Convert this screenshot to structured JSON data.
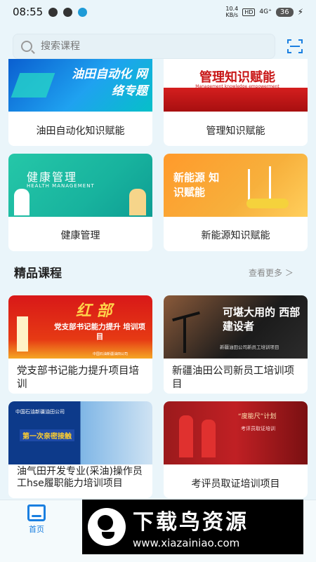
{
  "status_bar": {
    "time": "08:55",
    "net_speed": "10.4",
    "net_unit": "KB/s",
    "hd": "HD",
    "signal": "4G⁺",
    "battery": "36"
  },
  "search": {
    "placeholder": "搜索课程"
  },
  "top_categories": [
    {
      "label": "油田自动化知识赋能",
      "image_text": "油田自动化 网络专题"
    },
    {
      "label": "管理知识赋能",
      "image_text": "管理知识赋能",
      "image_sub": "Management knowledge empowerment"
    },
    {
      "label": "健康管理",
      "image_text": "健康管理",
      "image_sub": "HEALTH MANAGEMENT"
    },
    {
      "label": "新能源知识赋能",
      "image_text": "新能源 知识赋能"
    }
  ],
  "section": {
    "title": "精品课程",
    "more": "查看更多 ＞"
  },
  "courses": [
    {
      "title": "党支部书记能力提升项目培训",
      "image_main": "红 部",
      "image_sub": "党支部书记能力提升 培训项目",
      "image_org": "中国石油新疆油田公司"
    },
    {
      "title": "新疆油田公司新员工培训项目",
      "image_main": "可堪大用的 西部建设者",
      "image_sub": "新疆油田公司新员工培训项目"
    },
    {
      "title": "油气田开发专业(采油)操作员工hse履职能力培训项目",
      "image_main": "中国石油新疆油田公司",
      "image_sub": "第一次亲密接触"
    },
    {
      "title": "考评员取证培训项目",
      "image_main": "“度能尺”计划",
      "image_sub": "考评员取证培训"
    }
  ],
  "tabbar": {
    "home": "首页"
  },
  "watermark": {
    "title": "下载鸟资源",
    "url": "www.xiazainiao.com"
  }
}
